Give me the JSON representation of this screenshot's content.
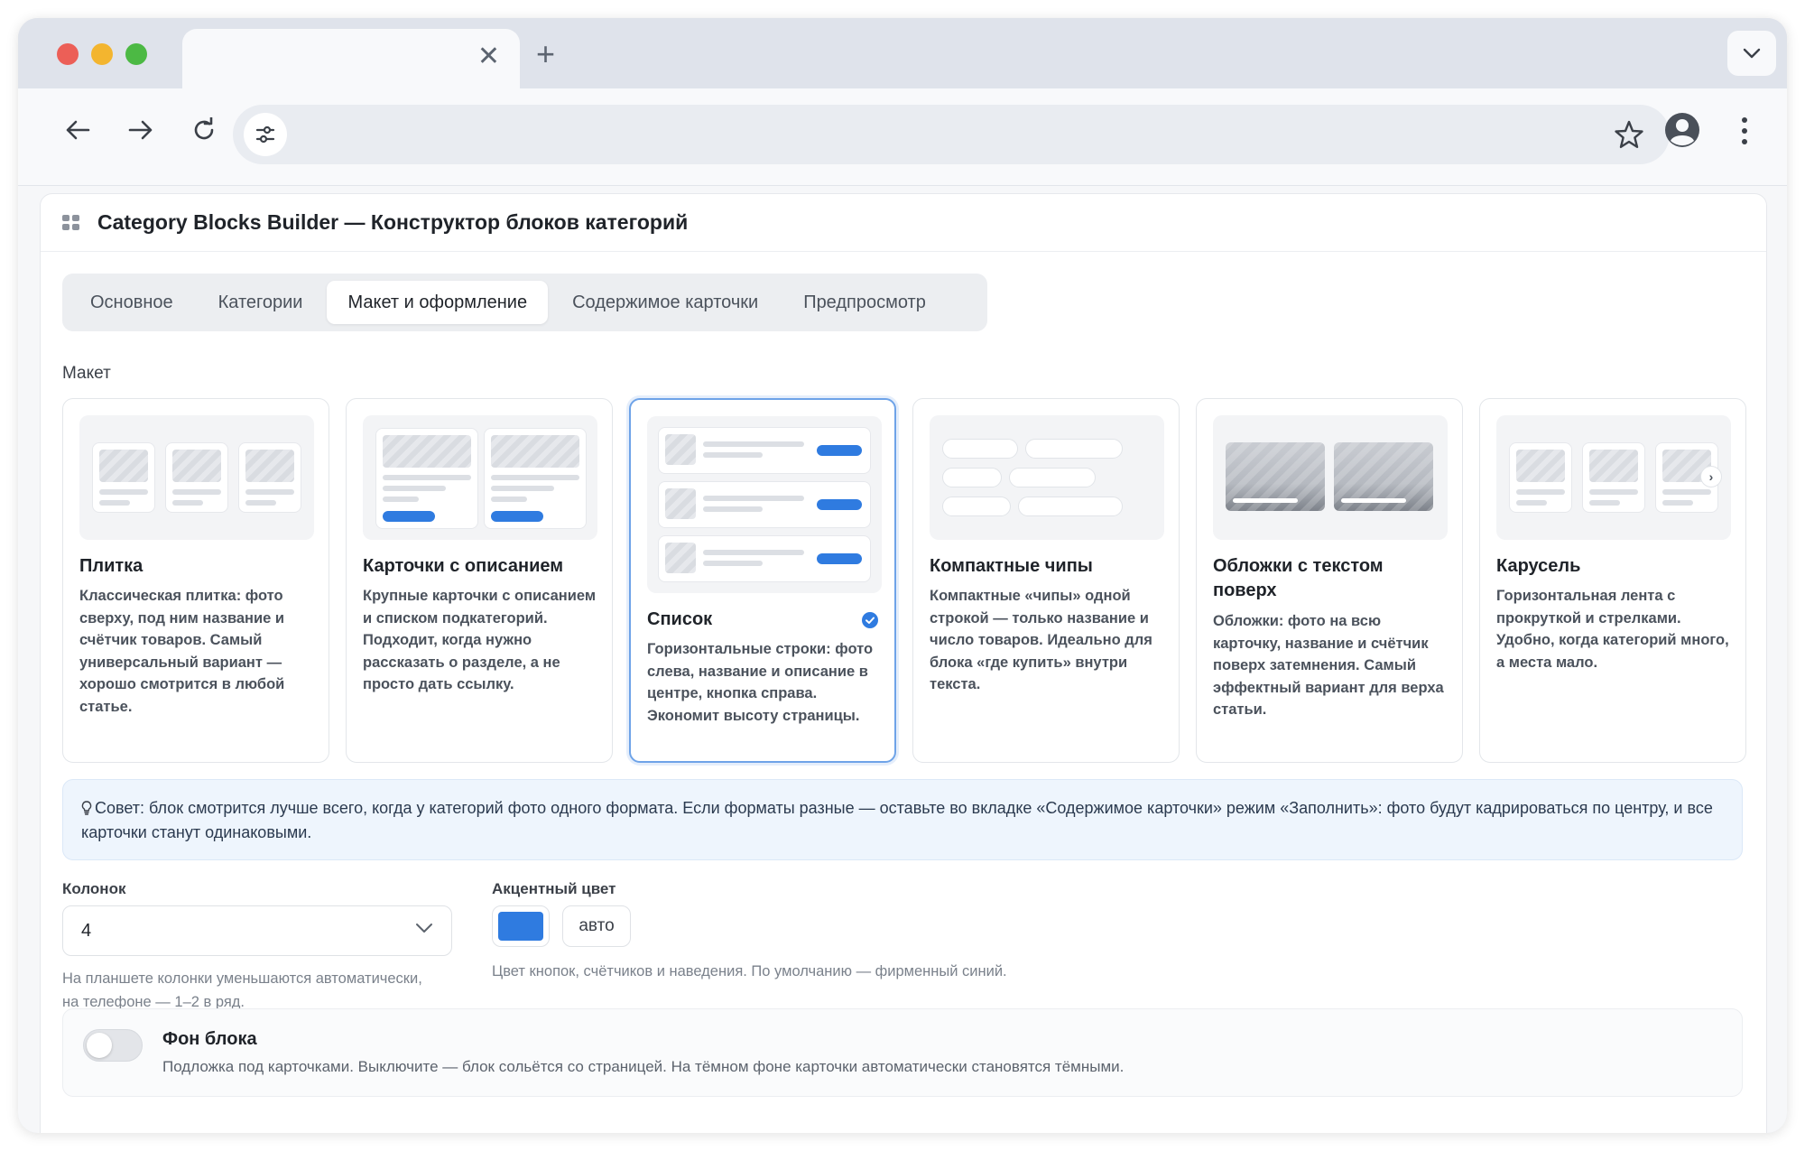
{
  "browser": {
    "tab_title": "",
    "tab_close_glyph": "✕",
    "new_tab_glyph": "+",
    "url": ""
  },
  "panel": {
    "title": "Category Blocks Builder — Конструктор блоков категорий"
  },
  "tabs": [
    {
      "label": "Основное",
      "active": false
    },
    {
      "label": "Категории",
      "active": false
    },
    {
      "label": "Макет и оформление",
      "active": true
    },
    {
      "label": "Содержимое карточки",
      "active": false
    },
    {
      "label": "Предпросмотр",
      "active": false
    }
  ],
  "layout_section": {
    "label": "Макет",
    "options": [
      {
        "title": "Плитка",
        "description": "Классическая плитка: фото сверху, под ним название и счётчик товаров. Самый универсальный вариант — хорошо смотрится в любой статье.",
        "selected": false
      },
      {
        "title": "Карточки с описанием",
        "description": "Крупные карточки с описанием и списком подкатегорий. Подходит, когда нужно рассказать о разделе, а не просто дать ссылку.",
        "selected": false
      },
      {
        "title": "Список",
        "description": "Горизонтальные строки: фото слева, название и описание в центре, кнопка справа. Экономит высоту страницы.",
        "selected": true
      },
      {
        "title": "Компактные чипы",
        "description": "Компактные «чипы» одной строкой — только название и число товаров. Идеально для блока «где купить» внутри текста.",
        "selected": false
      },
      {
        "title": "Обложки с текстом поверх",
        "description": "Обложки: фото на всю карточку, название и счётчик поверх затемнения. Самый эффектный вариант для верха статьи.",
        "selected": false
      },
      {
        "title": "Карусель",
        "description": "Горизонтальная лента с прокруткой и стрелками. Удобно, когда категорий много, а места мало.",
        "selected": false
      }
    ]
  },
  "tip": {
    "text": "Совет: блок смотрится лучше всего, когда у категорий фото одного формата. Если форматы разные — оставьте во вкладке «Содержимое карточки» режим «Заполнить»: фото будут кадрироваться по центру, и все карточки станут одинаковыми."
  },
  "columns": {
    "label": "Колонок",
    "value": "4",
    "hint": "На планшете колонки уменьшаются автоматически, на телефоне — 1–2 в ряд."
  },
  "accent": {
    "label": "Акцентный цвет",
    "color": "#2f7be0",
    "auto_label": "авто",
    "hint": "Цвет кнопок, счётчиков и наведения. По умолчанию — фирменный синий."
  },
  "background": {
    "title": "Фон блока",
    "description": "Подложка под карточками. Выключите — блок сольётся со страницей. На тёмном фоне карточки автоматически становятся тёмными.",
    "enabled": false
  },
  "colors": {
    "accent_blue": "#2f7be0",
    "selected_border": "#6ea3e8",
    "tip_background": "#eef5fd"
  }
}
